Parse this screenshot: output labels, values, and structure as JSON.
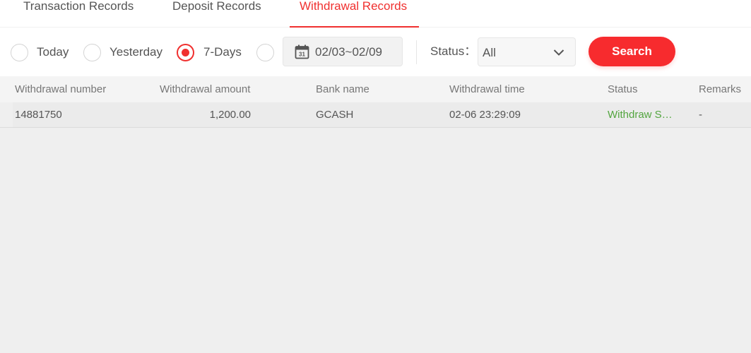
{
  "tabs": [
    {
      "label": "Transaction Records",
      "active": false
    },
    {
      "label": "Deposit Records",
      "active": false
    },
    {
      "label": "Withdrawal Records",
      "active": true
    }
  ],
  "filters": {
    "ranges": [
      {
        "label": "Today",
        "checked": false
      },
      {
        "label": "Yesterday",
        "checked": false
      },
      {
        "label": "7-Days",
        "checked": true
      },
      {
        "label": "",
        "checked": false
      }
    ],
    "date_range": "02/03~02/09",
    "date_icon_day": "31",
    "status_label": "Status：",
    "status_value": "All",
    "search_label": "Search"
  },
  "table": {
    "columns": [
      "Withdrawal number",
      "Withdrawal amount",
      "Bank name",
      "Withdrawal time",
      "Status",
      "Remarks"
    ],
    "rows": [
      {
        "number": "14881750",
        "amount": "1,200.00",
        "bank": "GCASH",
        "time": "02-06 23:29:09",
        "status": "Withdraw S…",
        "remarks": "-"
      }
    ]
  },
  "colors": {
    "accent": "#f0302f",
    "button": "#f72b2e",
    "success": "#53a53f",
    "page_bg": "#efefef"
  },
  "icons": [
    "calendar-icon",
    "chevron-down-icon"
  ]
}
